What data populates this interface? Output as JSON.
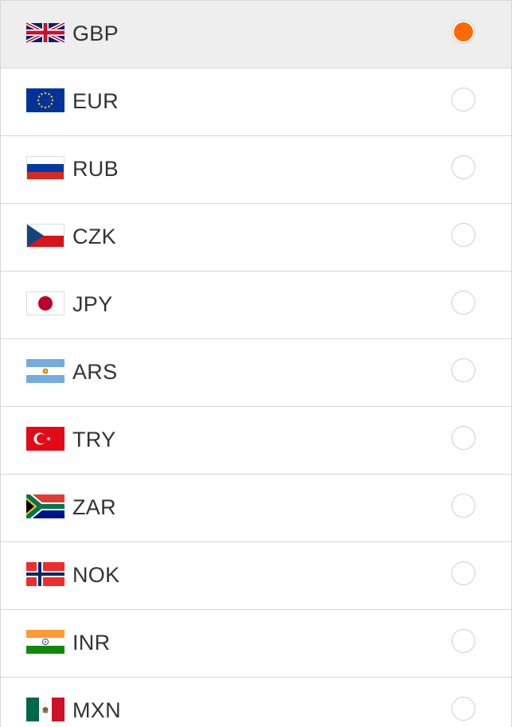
{
  "currencies": [
    {
      "code": "GBP",
      "flag_icon": "uk-flag-icon",
      "selected": true
    },
    {
      "code": "EUR",
      "flag_icon": "eu-flag-icon",
      "selected": false
    },
    {
      "code": "RUB",
      "flag_icon": "russia-flag-icon",
      "selected": false
    },
    {
      "code": "CZK",
      "flag_icon": "czech-flag-icon",
      "selected": false
    },
    {
      "code": "JPY",
      "flag_icon": "japan-flag-icon",
      "selected": false
    },
    {
      "code": "ARS",
      "flag_icon": "argentina-flag-icon",
      "selected": false
    },
    {
      "code": "TRY",
      "flag_icon": "turkey-flag-icon",
      "selected": false
    },
    {
      "code": "ZAR",
      "flag_icon": "south-africa-flag-icon",
      "selected": false
    },
    {
      "code": "NOK",
      "flag_icon": "norway-flag-icon",
      "selected": false
    },
    {
      "code": "INR",
      "flag_icon": "india-flag-icon",
      "selected": false
    },
    {
      "code": "MXN",
      "flag_icon": "mexico-flag-icon",
      "selected": false
    }
  ],
  "colors": {
    "selected_row_bg": "#eeeeee",
    "radio_accent": "#ff6a00",
    "divider": "#d6d6d6",
    "text": "#333333"
  }
}
